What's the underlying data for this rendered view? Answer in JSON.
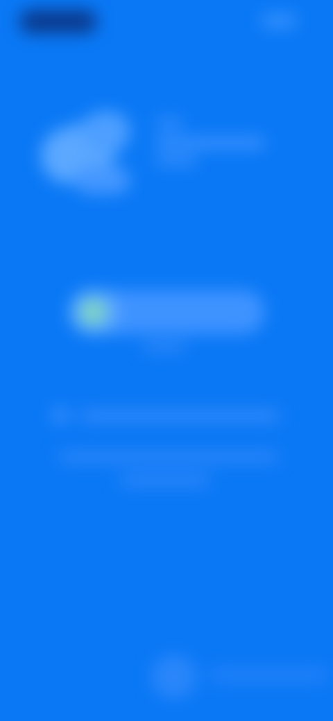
{
  "screen": {
    "background_color": "#0A78F5",
    "state": "blurred-loading"
  },
  "header": {
    "back_icon": "back-pill-icon",
    "action_icon": "more-icon"
  },
  "brand": {
    "logo_icon": "brand-logo-icon"
  },
  "progress": {
    "value_fraction": 0.25,
    "indicator_color": "#7FD8C0",
    "track_color": "#3F93FF",
    "fill_color": "#5FAAFF"
  },
  "info": {
    "icon": "info-icon"
  },
  "footer": {
    "watermark_icon": "footer-logo-icon"
  }
}
